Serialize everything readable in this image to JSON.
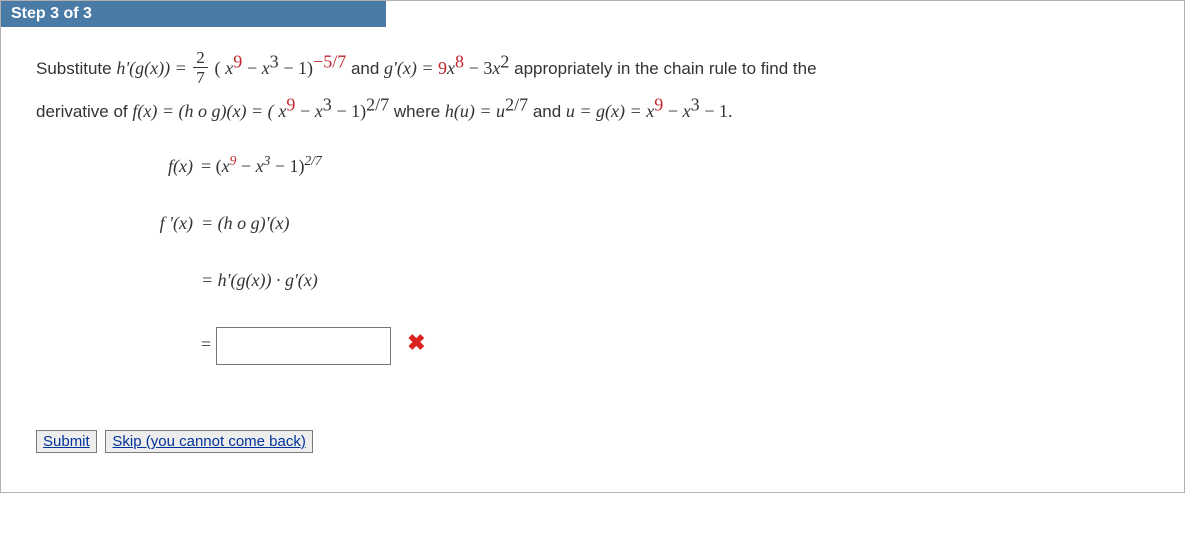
{
  "header": {
    "step_label": "Step 3 of 3"
  },
  "problem": {
    "intro1": "Substitute ",
    "expr1_lead": "h'(g(x)) = ",
    "frac1_num": "2",
    "frac1_den": "7",
    "expr1_paren_open": "(",
    "expr1_x9": "x",
    "expr1_x9_sup": "9",
    "expr1_minus1": " − ",
    "expr1_x3": "x",
    "expr1_x3_sup": "3",
    "expr1_minus2": " − 1)",
    "expr1_exp": "−5/7",
    "and1": " and ",
    "expr2": "g'(x) = ",
    "expr2_coef1": "9",
    "expr2_x8": "x",
    "expr2_x8_sup": "8",
    "expr2_minus": " − 3",
    "expr2_x2": "x",
    "expr2_x2_sup": "2",
    "tail1": "  appropriately in the chain rule to find the",
    "line2a": "derivative of ",
    "fx_eq": "f(x) = (h o g)(x) = (",
    "l2_x9": "x",
    "l2_x9_sup": "9",
    "l2_m1": " − ",
    "l2_x3": "x",
    "l2_x3_sup": "3",
    "l2_close": " − 1)",
    "l2_exp": "2/7",
    "where": "  where ",
    "hu": "h(u) = u",
    "hu_sup": "2/7",
    "and2": "  and ",
    "u_eq": "u = g(x) = ",
    "l2b_x9": "x",
    "l2b_x9_sup": "9",
    "l2b_m1": " − ",
    "l2b_x3": "x",
    "l2b_x3_sup": "3",
    "l2b_tail": " − 1."
  },
  "work": {
    "row1_left": "f(x)",
    "row1_right_open": " = (",
    "row1_x9": "x",
    "row1_x9_sup": "9",
    "row1_m1": " − ",
    "row1_x3": "x",
    "row1_x3_sup": "3",
    "row1_close": " − 1)",
    "row1_exp": "2/7",
    "row2_left": "f '(x)",
    "row2_right": " = (h o g)'(x)",
    "row3_right": " = h'(g(x)) · g'(x)",
    "row4_eq": " = "
  },
  "feedback": {
    "incorrect_symbol": "✖"
  },
  "buttons": {
    "submit": "Submit",
    "skip": "Skip (you cannot come back)"
  },
  "input": {
    "answer_value": ""
  }
}
